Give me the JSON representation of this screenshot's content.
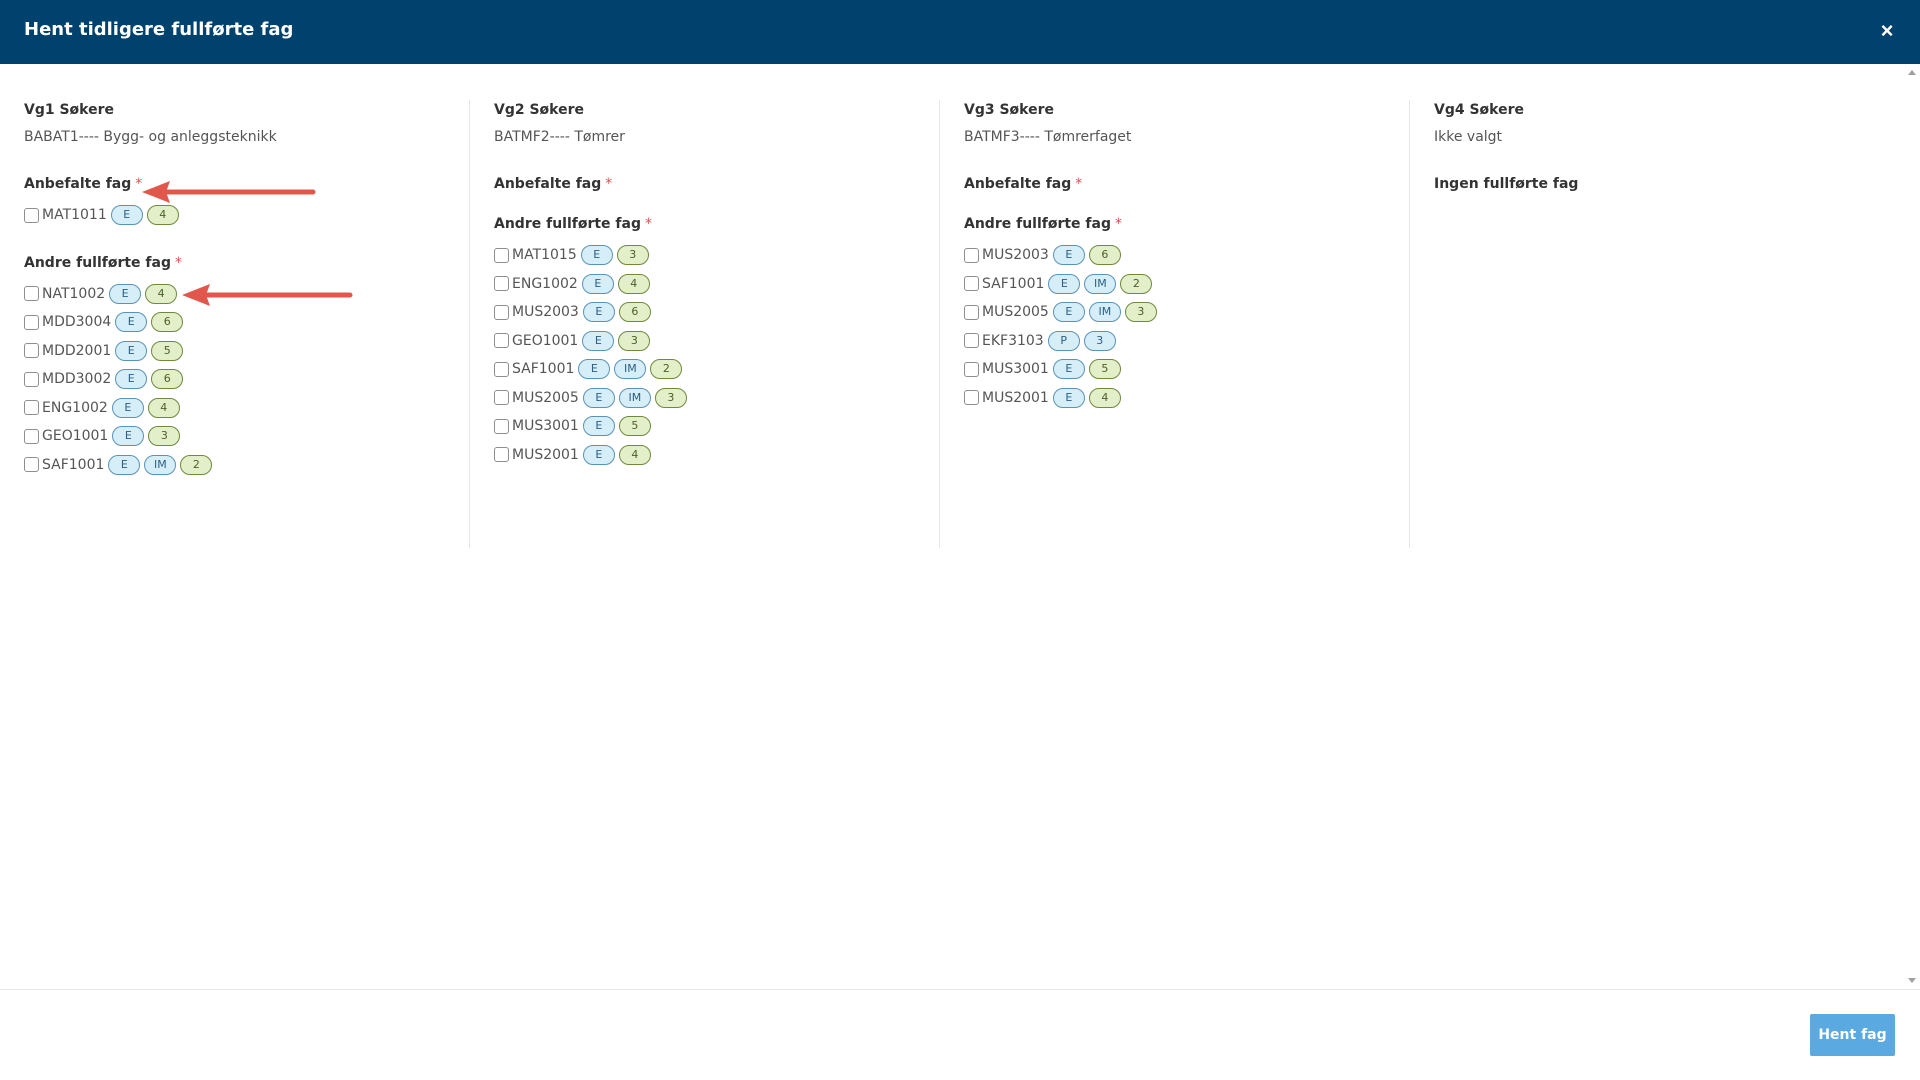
{
  "modal": {
    "title": "Hent tidligere fullførte fag",
    "close_label": "×",
    "submit_label": "Hent fag"
  },
  "columns": [
    {
      "title": "Vg1 Søkere",
      "program": "BABAT1---- Bygg- og anleggsteknikk",
      "recommended_label": "Anbefalte fag",
      "recommended": [
        {
          "code": "MAT1011",
          "badges": [
            {
              "text": "E",
              "tone": "blue"
            },
            {
              "text": "4",
              "tone": "green"
            }
          ]
        }
      ],
      "other_label": "Andre fullførte fag",
      "other": [
        {
          "code": "NAT1002",
          "badges": [
            {
              "text": "E",
              "tone": "blue"
            },
            {
              "text": "4",
              "tone": "green"
            }
          ]
        },
        {
          "code": "MDD3004",
          "badges": [
            {
              "text": "E",
              "tone": "blue"
            },
            {
              "text": "6",
              "tone": "green"
            }
          ]
        },
        {
          "code": "MDD2001",
          "badges": [
            {
              "text": "E",
              "tone": "blue"
            },
            {
              "text": "5",
              "tone": "green"
            }
          ]
        },
        {
          "code": "MDD3002",
          "badges": [
            {
              "text": "E",
              "tone": "blue"
            },
            {
              "text": "6",
              "tone": "green"
            }
          ]
        },
        {
          "code": "ENG1002",
          "badges": [
            {
              "text": "E",
              "tone": "blue"
            },
            {
              "text": "4",
              "tone": "green"
            }
          ]
        },
        {
          "code": "GEO1001",
          "badges": [
            {
              "text": "E",
              "tone": "blue"
            },
            {
              "text": "3",
              "tone": "green"
            }
          ]
        },
        {
          "code": "SAF1001",
          "badges": [
            {
              "text": "E",
              "tone": "blue"
            },
            {
              "text": "IM",
              "tone": "blue"
            },
            {
              "text": "2",
              "tone": "green"
            }
          ]
        }
      ]
    },
    {
      "title": "Vg2 Søkere",
      "program": "BATMF2---- Tømrer",
      "recommended_label": "Anbefalte fag",
      "recommended": [],
      "other_label": "Andre fullførte fag",
      "other": [
        {
          "code": "MAT1015",
          "badges": [
            {
              "text": "E",
              "tone": "blue"
            },
            {
              "text": "3",
              "tone": "green"
            }
          ]
        },
        {
          "code": "ENG1002",
          "badges": [
            {
              "text": "E",
              "tone": "blue"
            },
            {
              "text": "4",
              "tone": "green"
            }
          ]
        },
        {
          "code": "MUS2003",
          "badges": [
            {
              "text": "E",
              "tone": "blue"
            },
            {
              "text": "6",
              "tone": "green"
            }
          ]
        },
        {
          "code": "GEO1001",
          "badges": [
            {
              "text": "E",
              "tone": "blue"
            },
            {
              "text": "3",
              "tone": "green"
            }
          ]
        },
        {
          "code": "SAF1001",
          "badges": [
            {
              "text": "E",
              "tone": "blue"
            },
            {
              "text": "IM",
              "tone": "blue"
            },
            {
              "text": "2",
              "tone": "green"
            }
          ]
        },
        {
          "code": "MUS2005",
          "badges": [
            {
              "text": "E",
              "tone": "blue"
            },
            {
              "text": "IM",
              "tone": "blue"
            },
            {
              "text": "3",
              "tone": "green"
            }
          ]
        },
        {
          "code": "MUS3001",
          "badges": [
            {
              "text": "E",
              "tone": "blue"
            },
            {
              "text": "5",
              "tone": "green"
            }
          ]
        },
        {
          "code": "MUS2001",
          "badges": [
            {
              "text": "E",
              "tone": "blue"
            },
            {
              "text": "4",
              "tone": "green"
            }
          ]
        }
      ]
    },
    {
      "title": "Vg3 Søkere",
      "program": "BATMF3---- Tømrerfaget",
      "recommended_label": "Anbefalte fag",
      "recommended": [],
      "other_label": "Andre fullførte fag",
      "other": [
        {
          "code": "MUS2003",
          "badges": [
            {
              "text": "E",
              "tone": "blue"
            },
            {
              "text": "6",
              "tone": "green"
            }
          ]
        },
        {
          "code": "SAF1001",
          "badges": [
            {
              "text": "E",
              "tone": "blue"
            },
            {
              "text": "IM",
              "tone": "blue"
            },
            {
              "text": "2",
              "tone": "green"
            }
          ]
        },
        {
          "code": "MUS2005",
          "badges": [
            {
              "text": "E",
              "tone": "blue"
            },
            {
              "text": "IM",
              "tone": "blue"
            },
            {
              "text": "3",
              "tone": "green"
            }
          ]
        },
        {
          "code": "EKF3103",
          "badges": [
            {
              "text": "P",
              "tone": "blue"
            },
            {
              "text": "3",
              "tone": "blue"
            }
          ]
        },
        {
          "code": "MUS3001",
          "badges": [
            {
              "text": "E",
              "tone": "blue"
            },
            {
              "text": "5",
              "tone": "green"
            }
          ]
        },
        {
          "code": "MUS2001",
          "badges": [
            {
              "text": "E",
              "tone": "blue"
            },
            {
              "text": "4",
              "tone": "green"
            }
          ]
        }
      ]
    },
    {
      "title": "Vg4 Søkere",
      "program": "Ikke valgt",
      "empty_label": "Ingen fullførte fag"
    }
  ],
  "required_mark": "*",
  "colors": {
    "header_bg": "#00426e",
    "primary_button": "#5aa9e0",
    "required": "#d9534f",
    "annotation_arrow": "#e2574c",
    "badge_blue": "#d6eef8",
    "badge_green": "#e3efc8"
  }
}
